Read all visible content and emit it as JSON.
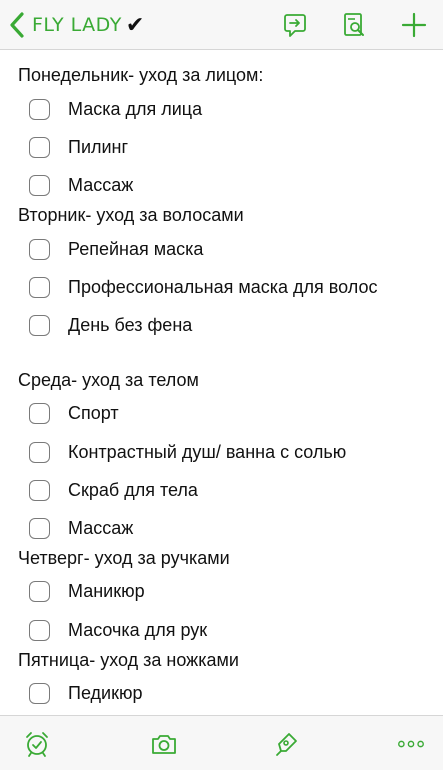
{
  "header": {
    "back_label": "FLY LADY",
    "check_mark": "✔",
    "accent_color": "#3aaa35"
  },
  "note": {
    "sections": [
      {
        "heading": "Понедельник- уход за лицом:",
        "items": [
          "Маска для лица",
          "Пилинг",
          "Массаж"
        ]
      },
      {
        "heading": " Вторник- уход за волосами",
        "items": [
          "Репейная маска",
          "Профессиональная маска для волос",
          "День без фена"
        ]
      },
      {
        "heading": "Среда- уход за телом",
        "items": [
          "Спорт",
          "Контрастный душ/ ванна с солью",
          "Скраб для тела",
          "Массаж"
        ]
      },
      {
        "heading": "Четверг- уход за ручками",
        "items": [
          "Маникюр",
          "Масочка для рук"
        ]
      },
      {
        "heading": "Пятница- уход за ножками",
        "items": [
          "Педикюр"
        ]
      }
    ]
  },
  "toolbar_icons": [
    "share-icon",
    "search-in-note-icon",
    "add-icon"
  ],
  "bottom_icons": [
    "reminder-alarm-icon",
    "camera-icon",
    "pen-icon",
    "more-icon"
  ]
}
